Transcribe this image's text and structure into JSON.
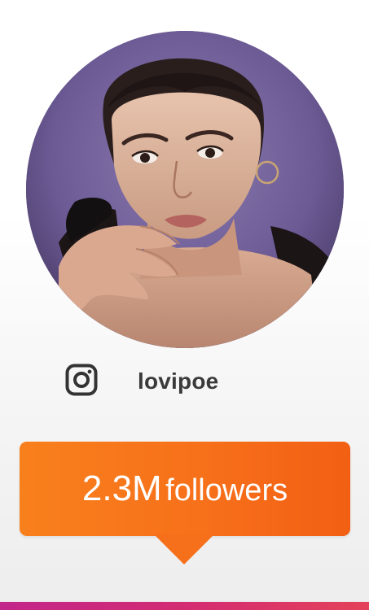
{
  "profile": {
    "platform_icon": "instagram-icon",
    "handle": "lovipoe",
    "photo_description_icon": "profile-photo"
  },
  "followers": {
    "count": "2.3M",
    "label": "followers"
  },
  "colors": {
    "badge": "#f7701a",
    "bottom_bar": "#d32c72",
    "handle_text": "#3a3a3a"
  }
}
